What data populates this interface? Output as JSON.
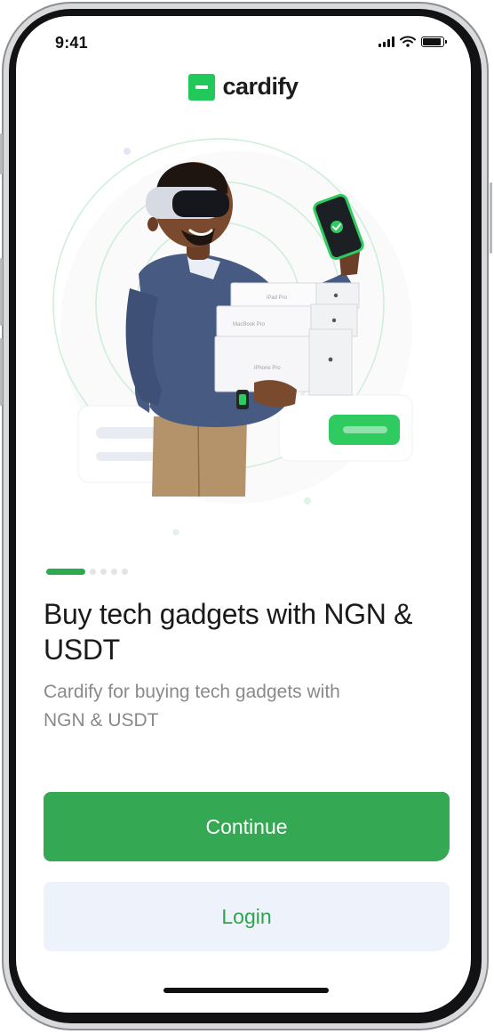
{
  "status_bar": {
    "time": "9:41",
    "signal_icon": "cellular-signal-icon",
    "wifi_icon": "wifi-icon",
    "battery_icon": "battery-icon",
    "battery_level": 0.85
  },
  "brand": {
    "name": "cardify",
    "accent": "#21c85a"
  },
  "hero": {
    "illustration": "man-with-vr-headset-holding-gadget-boxes",
    "box_labels": [
      "iPad Pro",
      "MacBook Pro",
      "iPhone Pro"
    ]
  },
  "onboarding": {
    "page_count": 5,
    "current_page": 1,
    "headline": "Buy tech gadgets with NGN & USDT",
    "subtitle": "Cardify for buying tech gadgets with NGN & USDT"
  },
  "actions": {
    "continue_label": "Continue",
    "login_label": "Login"
  },
  "colors": {
    "primary": "#34a853",
    "secondary_bg": "#eef2fb",
    "secondary_text": "#2ea44f",
    "headline_text": "#1a1a1a",
    "subtitle_text": "#8a8a8a"
  }
}
